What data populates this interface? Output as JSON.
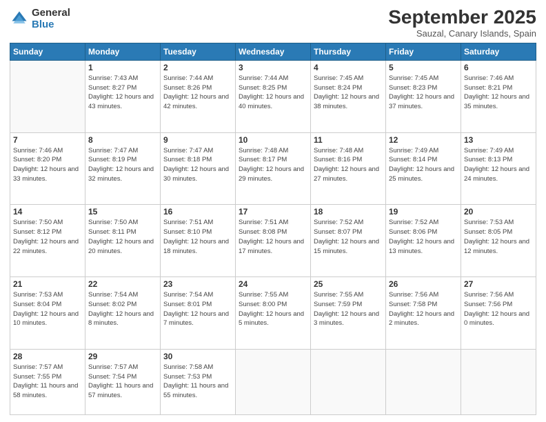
{
  "logo": {
    "line1": "General",
    "line2": "Blue"
  },
  "title": "September 2025",
  "subtitle": "Sauzal, Canary Islands, Spain",
  "headers": [
    "Sunday",
    "Monday",
    "Tuesday",
    "Wednesday",
    "Thursday",
    "Friday",
    "Saturday"
  ],
  "weeks": [
    [
      {
        "day": "",
        "sunrise": "",
        "sunset": "",
        "daylight": ""
      },
      {
        "day": "1",
        "sunrise": "Sunrise: 7:43 AM",
        "sunset": "Sunset: 8:27 PM",
        "daylight": "Daylight: 12 hours and 43 minutes."
      },
      {
        "day": "2",
        "sunrise": "Sunrise: 7:44 AM",
        "sunset": "Sunset: 8:26 PM",
        "daylight": "Daylight: 12 hours and 42 minutes."
      },
      {
        "day": "3",
        "sunrise": "Sunrise: 7:44 AM",
        "sunset": "Sunset: 8:25 PM",
        "daylight": "Daylight: 12 hours and 40 minutes."
      },
      {
        "day": "4",
        "sunrise": "Sunrise: 7:45 AM",
        "sunset": "Sunset: 8:24 PM",
        "daylight": "Daylight: 12 hours and 38 minutes."
      },
      {
        "day": "5",
        "sunrise": "Sunrise: 7:45 AM",
        "sunset": "Sunset: 8:23 PM",
        "daylight": "Daylight: 12 hours and 37 minutes."
      },
      {
        "day": "6",
        "sunrise": "Sunrise: 7:46 AM",
        "sunset": "Sunset: 8:21 PM",
        "daylight": "Daylight: 12 hours and 35 minutes."
      }
    ],
    [
      {
        "day": "7",
        "sunrise": "Sunrise: 7:46 AM",
        "sunset": "Sunset: 8:20 PM",
        "daylight": "Daylight: 12 hours and 33 minutes."
      },
      {
        "day": "8",
        "sunrise": "Sunrise: 7:47 AM",
        "sunset": "Sunset: 8:19 PM",
        "daylight": "Daylight: 12 hours and 32 minutes."
      },
      {
        "day": "9",
        "sunrise": "Sunrise: 7:47 AM",
        "sunset": "Sunset: 8:18 PM",
        "daylight": "Daylight: 12 hours and 30 minutes."
      },
      {
        "day": "10",
        "sunrise": "Sunrise: 7:48 AM",
        "sunset": "Sunset: 8:17 PM",
        "daylight": "Daylight: 12 hours and 29 minutes."
      },
      {
        "day": "11",
        "sunrise": "Sunrise: 7:48 AM",
        "sunset": "Sunset: 8:16 PM",
        "daylight": "Daylight: 12 hours and 27 minutes."
      },
      {
        "day": "12",
        "sunrise": "Sunrise: 7:49 AM",
        "sunset": "Sunset: 8:14 PM",
        "daylight": "Daylight: 12 hours and 25 minutes."
      },
      {
        "day": "13",
        "sunrise": "Sunrise: 7:49 AM",
        "sunset": "Sunset: 8:13 PM",
        "daylight": "Daylight: 12 hours and 24 minutes."
      }
    ],
    [
      {
        "day": "14",
        "sunrise": "Sunrise: 7:50 AM",
        "sunset": "Sunset: 8:12 PM",
        "daylight": "Daylight: 12 hours and 22 minutes."
      },
      {
        "day": "15",
        "sunrise": "Sunrise: 7:50 AM",
        "sunset": "Sunset: 8:11 PM",
        "daylight": "Daylight: 12 hours and 20 minutes."
      },
      {
        "day": "16",
        "sunrise": "Sunrise: 7:51 AM",
        "sunset": "Sunset: 8:10 PM",
        "daylight": "Daylight: 12 hours and 18 minutes."
      },
      {
        "day": "17",
        "sunrise": "Sunrise: 7:51 AM",
        "sunset": "Sunset: 8:08 PM",
        "daylight": "Daylight: 12 hours and 17 minutes."
      },
      {
        "day": "18",
        "sunrise": "Sunrise: 7:52 AM",
        "sunset": "Sunset: 8:07 PM",
        "daylight": "Daylight: 12 hours and 15 minutes."
      },
      {
        "day": "19",
        "sunrise": "Sunrise: 7:52 AM",
        "sunset": "Sunset: 8:06 PM",
        "daylight": "Daylight: 12 hours and 13 minutes."
      },
      {
        "day": "20",
        "sunrise": "Sunrise: 7:53 AM",
        "sunset": "Sunset: 8:05 PM",
        "daylight": "Daylight: 12 hours and 12 minutes."
      }
    ],
    [
      {
        "day": "21",
        "sunrise": "Sunrise: 7:53 AM",
        "sunset": "Sunset: 8:04 PM",
        "daylight": "Daylight: 12 hours and 10 minutes."
      },
      {
        "day": "22",
        "sunrise": "Sunrise: 7:54 AM",
        "sunset": "Sunset: 8:02 PM",
        "daylight": "Daylight: 12 hours and 8 minutes."
      },
      {
        "day": "23",
        "sunrise": "Sunrise: 7:54 AM",
        "sunset": "Sunset: 8:01 PM",
        "daylight": "Daylight: 12 hours and 7 minutes."
      },
      {
        "day": "24",
        "sunrise": "Sunrise: 7:55 AM",
        "sunset": "Sunset: 8:00 PM",
        "daylight": "Daylight: 12 hours and 5 minutes."
      },
      {
        "day": "25",
        "sunrise": "Sunrise: 7:55 AM",
        "sunset": "Sunset: 7:59 PM",
        "daylight": "Daylight: 12 hours and 3 minutes."
      },
      {
        "day": "26",
        "sunrise": "Sunrise: 7:56 AM",
        "sunset": "Sunset: 7:58 PM",
        "daylight": "Daylight: 12 hours and 2 minutes."
      },
      {
        "day": "27",
        "sunrise": "Sunrise: 7:56 AM",
        "sunset": "Sunset: 7:56 PM",
        "daylight": "Daylight: 12 hours and 0 minutes."
      }
    ],
    [
      {
        "day": "28",
        "sunrise": "Sunrise: 7:57 AM",
        "sunset": "Sunset: 7:55 PM",
        "daylight": "Daylight: 11 hours and 58 minutes."
      },
      {
        "day": "29",
        "sunrise": "Sunrise: 7:57 AM",
        "sunset": "Sunset: 7:54 PM",
        "daylight": "Daylight: 11 hours and 57 minutes."
      },
      {
        "day": "30",
        "sunrise": "Sunrise: 7:58 AM",
        "sunset": "Sunset: 7:53 PM",
        "daylight": "Daylight: 11 hours and 55 minutes."
      },
      {
        "day": "",
        "sunrise": "",
        "sunset": "",
        "daylight": ""
      },
      {
        "day": "",
        "sunrise": "",
        "sunset": "",
        "daylight": ""
      },
      {
        "day": "",
        "sunrise": "",
        "sunset": "",
        "daylight": ""
      },
      {
        "day": "",
        "sunrise": "",
        "sunset": "",
        "daylight": ""
      }
    ]
  ]
}
